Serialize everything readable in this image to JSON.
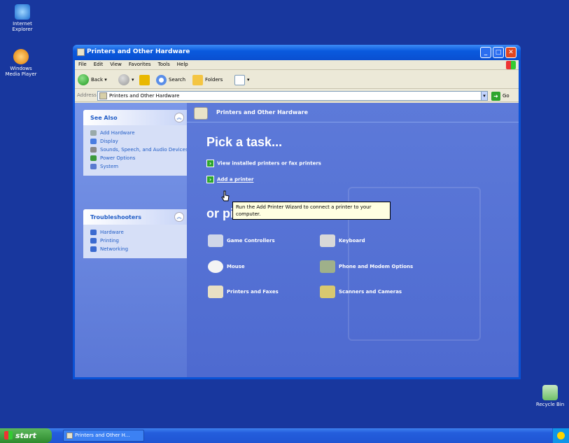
{
  "desktop": {
    "icons": [
      {
        "label": "Internet Explorer"
      },
      {
        "label": "Windows Media Player"
      },
      {
        "label": "Recycle Bin"
      }
    ]
  },
  "window": {
    "title": "Printers and Other Hardware",
    "controls": {
      "minimize": "_",
      "maximize": "□",
      "close": "✕"
    }
  },
  "menubar": [
    "File",
    "Edit",
    "View",
    "Favorites",
    "Tools",
    "Help"
  ],
  "toolbar": {
    "back": "Back",
    "search": "Search",
    "folders": "Folders",
    "dropdown": "▾"
  },
  "address": {
    "label": "Address",
    "value": "Printers and Other Hardware",
    "go": "Go"
  },
  "see_also": {
    "title": "See Also",
    "items": [
      "Add Hardware",
      "Display",
      "Sounds, Speech, and Audio Devices",
      "Power Options",
      "System"
    ]
  },
  "troubleshooters": {
    "title": "Troubleshooters",
    "items": [
      "Hardware",
      "Printing",
      "Networking"
    ]
  },
  "main": {
    "header": "Printers and Other Hardware",
    "pick_task": "Pick a task...",
    "tasks": [
      "View installed printers or fax printers",
      "Add a printer"
    ],
    "or_pick": "or pick a Control Panel icon",
    "icons": [
      "Game Controllers",
      "Keyboard",
      "Mouse",
      "Phone and Modem Options",
      "Printers and Faxes",
      "Scanners and Cameras"
    ],
    "tooltip": "Run the Add Printer Wizard to connect a printer to your computer."
  },
  "taskbar": {
    "start": "start",
    "task": "Printers and Other H..."
  },
  "colors": {
    "desktop": "#18379e",
    "titlebar": "#0a5ade",
    "taskpane_link": "#215dc6",
    "start_green": "#2d8a2d"
  }
}
